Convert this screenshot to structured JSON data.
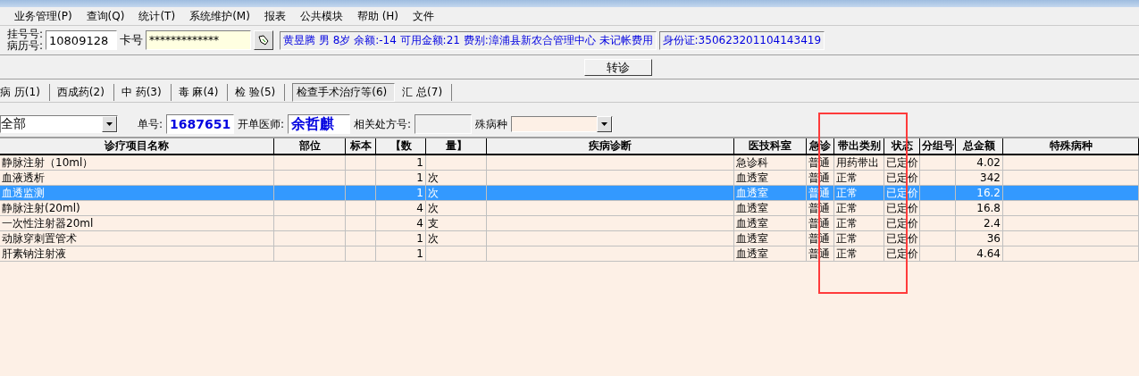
{
  "menu": [
    {
      "label": "业务管理(P)"
    },
    {
      "label": "查询(Q)"
    },
    {
      "label": "统计(T)"
    },
    {
      "label": "系统维护(M)"
    },
    {
      "label": "报表"
    },
    {
      "label": "公共模块"
    },
    {
      "label": "帮助 (H)"
    },
    {
      "label": "文件"
    }
  ],
  "patient": {
    "registration_label": "挂号号:",
    "record_label": "病历号:",
    "record_value": "10809128",
    "card_label": "卡号",
    "card_value": "*************",
    "info": "黄昱腾 男 8岁 余额:-14 可用金额:21 费别:漳浦县新农合管理中心 未记帐费用",
    "id_card": "身份证:350623201104143419"
  },
  "transfer_button": "转诊",
  "tabs": [
    {
      "label": "病 历(1)",
      "selected": false
    },
    {
      "label": "西成药(2)",
      "selected": false
    },
    {
      "label": "中 药(3)",
      "selected": false
    },
    {
      "label": "毒 麻(4)",
      "selected": false
    },
    {
      "label": "检 验(5)",
      "selected": false
    },
    {
      "label": "检查手术治疗等(6)",
      "selected": true
    },
    {
      "label": "汇 总(7)",
      "selected": false
    }
  ],
  "filter": {
    "category": "全部",
    "order_label": "单号:",
    "order_value": "1687651",
    "doctor_label": "开单医师:",
    "doctor_value": "余哲麒",
    "related_label": "相关处方号:",
    "special_label": "殊病种"
  },
  "table": {
    "columns": [
      "诊疗项目名称",
      "部位",
      "标本",
      "【数",
      "量】",
      "疾病诊断",
      "医技科室",
      "急诊",
      "带出类别",
      "状态",
      "分组号",
      "总金额",
      "特殊病种"
    ],
    "rows": [
      {
        "selected": false,
        "cells": [
          "静脉注射（10ml）",
          "",
          "",
          "1",
          "",
          "",
          "急诊科",
          "普通",
          "用药带出",
          "已定价",
          "",
          "4.02",
          ""
        ]
      },
      {
        "selected": false,
        "cells": [
          "血液透析",
          "",
          "",
          "1",
          "次",
          "",
          "血透室",
          "普通",
          "正常",
          "已定价",
          "",
          "342",
          ""
        ]
      },
      {
        "selected": true,
        "cells": [
          "血透监测",
          "",
          "",
          "1",
          "次",
          "",
          "血透室",
          "普通",
          "正常",
          "已定价",
          "",
          "16.2",
          ""
        ]
      },
      {
        "selected": false,
        "cells": [
          "静脉注射(20ml)",
          "",
          "",
          "4",
          "次",
          "",
          "血透室",
          "普通",
          "正常",
          "已定价",
          "",
          "16.8",
          ""
        ]
      },
      {
        "selected": false,
        "cells": [
          "一次性注射器20ml",
          "",
          "",
          "4",
          "支",
          "",
          "血透室",
          "普通",
          "正常",
          "已定价",
          "",
          "2.4",
          ""
        ]
      },
      {
        "selected": false,
        "cells": [
          "动脉穿刺置管术",
          "",
          "",
          "1",
          "次",
          "",
          "血透室",
          "普通",
          "正常",
          "已定价",
          "",
          "36",
          ""
        ]
      },
      {
        "selected": false,
        "cells": [
          "肝素钠注射液",
          "",
          "",
          "1",
          "",
          "",
          "血透室",
          "普通",
          "正常",
          "已定价",
          "",
          "4.64",
          ""
        ]
      }
    ]
  }
}
